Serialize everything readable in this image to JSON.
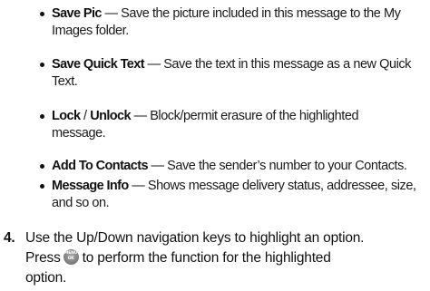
{
  "bullets": [
    {
      "term": "Save Pic",
      "separator": "—",
      "description_line1": "Save the picture included in this message to the My",
      "description_line2": "Images folder."
    },
    {
      "term": "Save Quick Text",
      "separator": "—",
      "description_line1": "Save the text in this message as a new Quick",
      "description_line2": "Text."
    },
    {
      "term_part1": "Lock",
      "term_slash": " / ",
      "term_part2": "Unlock",
      "separator": "—",
      "description_line1": "Block/permit erasure of the highlighted",
      "description_line2": "message."
    },
    {
      "term": "Add To Contacts",
      "separator": "—",
      "description_line1": "Save the sender’s number to your Contacts."
    },
    {
      "term": "Message Info",
      "separator": "—",
      "description_line1": "Shows message delivery status, addressee, size,",
      "description_line2": "and so on."
    }
  ],
  "step": {
    "number": "4.",
    "line1": "Use the Up/Down navigation keys to highlight an option.",
    "line2_before": "Press",
    "line2_after": "to perform the function for the highlighted",
    "line3": "option.",
    "icon": {
      "name": "menu-ok-key-icon",
      "top_label": "MENU",
      "bottom_label": "OK"
    }
  }
}
